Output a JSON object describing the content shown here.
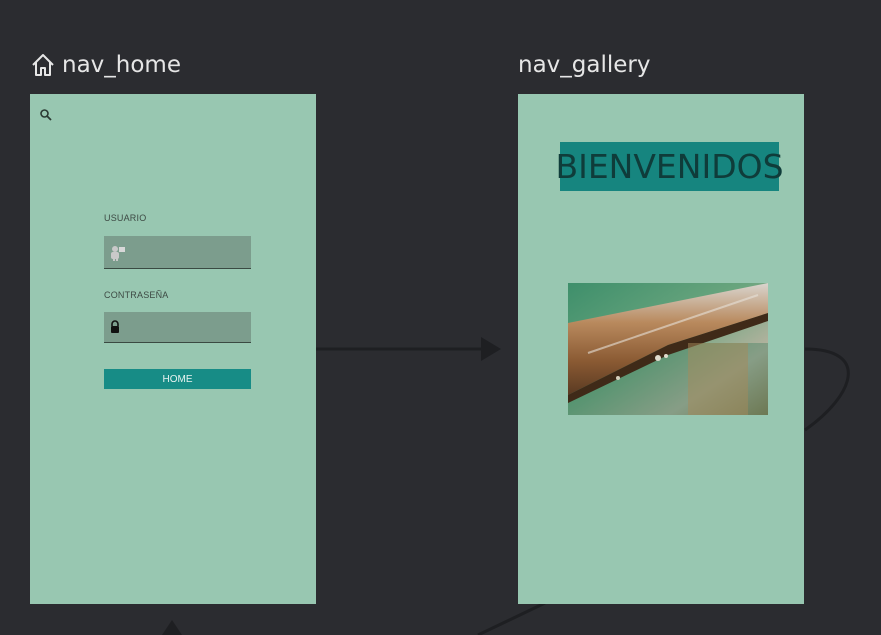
{
  "destinations": {
    "home": {
      "title": "nav_home",
      "title_icon": "home-icon",
      "toolbar_icon": "search-icon",
      "username_label": "USUARIO",
      "username_icon": "person-icon",
      "password_label": "CONTRASEÑA",
      "password_icon": "lock-icon",
      "button_label": "HOME"
    },
    "gallery": {
      "title": "nav_gallery",
      "welcome_text": "BIENVENIDOS",
      "image": "wet-wood-plank-photo"
    }
  },
  "colors": {
    "canvas": "#2b2c30",
    "screen_bg": "#98c7b1",
    "accent": "#178c86",
    "field_bg": "#7c9d8d",
    "connector": "#1e1f22"
  }
}
